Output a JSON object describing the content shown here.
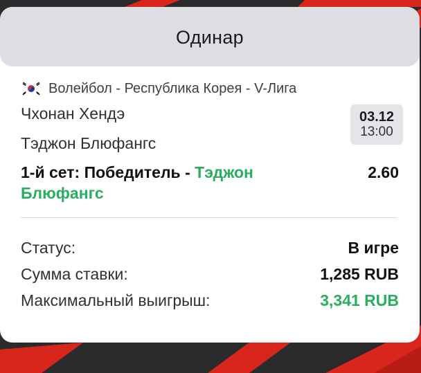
{
  "card": {
    "title": "Одинар"
  },
  "event": {
    "league": "Волейбол - Республика Корея - V-Лига",
    "flag_icon": "south-korea-flag-icon",
    "home_team": "Чхонан Хендэ",
    "away_team": "Тэджон Блюфангс",
    "date": "03.12",
    "time": "13:00"
  },
  "bet": {
    "market": "1-й сет: Победитель",
    "separator": " - ",
    "pick": "Тэджон Блюфангс",
    "odds": "2.60"
  },
  "details": {
    "status_label": "Статус:",
    "status_value": "В игре",
    "stake_label": "Сумма ставки:",
    "stake_value": "1,285 RUB",
    "payout_label": "Максимальный выигрыш:",
    "payout_value": "3,341 RUB"
  },
  "colors": {
    "accent_green": "#27ae5f",
    "stripe_red": "#d9261c",
    "background_dark": "#2b2b2d",
    "header_gray": "#dcdee2"
  }
}
